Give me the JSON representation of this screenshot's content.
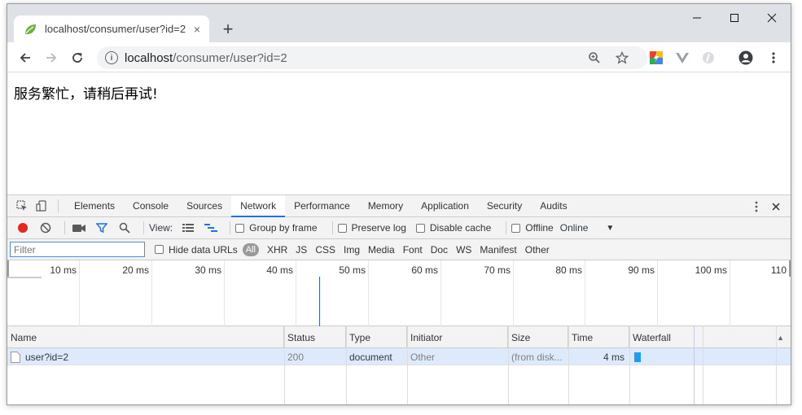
{
  "tab": {
    "title": "localhost/consumer/user?id=2",
    "close": "×",
    "new_tab": "+"
  },
  "window_controls": {
    "minimize": "—",
    "maximize": "☐",
    "close": "✕"
  },
  "address": {
    "host": "localhost",
    "path": "/consumer/user?id=2"
  },
  "page": {
    "message": "服务繁忙，请稍后再试!"
  },
  "devtools": {
    "tabs": [
      "Elements",
      "Console",
      "Sources",
      "Network",
      "Performance",
      "Memory",
      "Application",
      "Security",
      "Audits"
    ],
    "active_tab": "Network",
    "toolbar": {
      "view_label": "View:",
      "group_by_frame": "Group by frame",
      "preserve_log": "Preserve log",
      "disable_cache": "Disable cache",
      "offline": "Offline",
      "throttling": "Online"
    },
    "filter": {
      "placeholder": "Filter",
      "hide_data_urls": "Hide data URLs",
      "all": "All",
      "types": [
        "XHR",
        "JS",
        "CSS",
        "Img",
        "Media",
        "Font",
        "Doc",
        "WS",
        "Manifest",
        "Other"
      ]
    },
    "timeline_ticks": [
      "10 ms",
      "20 ms",
      "30 ms",
      "40 ms",
      "50 ms",
      "60 ms",
      "70 ms",
      "80 ms",
      "90 ms",
      "100 ms",
      "110"
    ],
    "columns": [
      "Name",
      "Status",
      "Type",
      "Initiator",
      "Size",
      "Time",
      "Waterfall"
    ],
    "rows": [
      {
        "name": "user?id=2",
        "status": "200",
        "type": "document",
        "initiator": "Other",
        "size": "(from disk...",
        "time": "4 ms"
      }
    ],
    "colors": {
      "accent": "#1a73e8",
      "record": "#e8261e",
      "selected_row": "#dceafc",
      "waterfall_bar": "#1a9ff5"
    }
  }
}
